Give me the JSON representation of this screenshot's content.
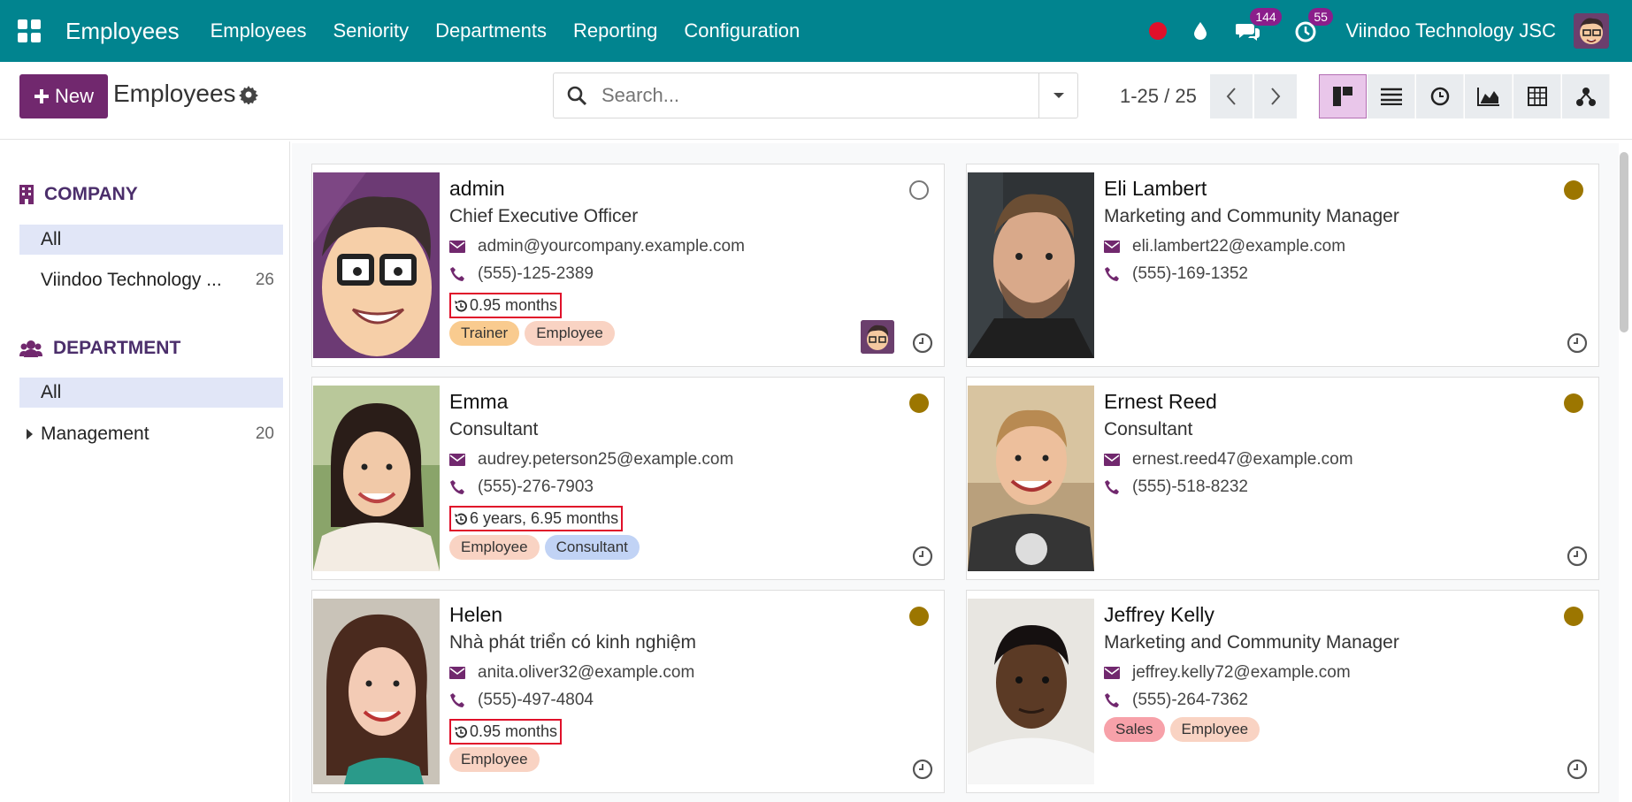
{
  "navbar": {
    "app_title": "Employees",
    "menu": [
      "Employees",
      "Seniority",
      "Departments",
      "Reporting",
      "Configuration"
    ],
    "messages_count": "144",
    "activities_count": "55",
    "company": "Viindoo Technology JSC",
    "accent": "#01848f"
  },
  "control": {
    "new_label": "New",
    "breadcrumb": "Employees",
    "search_placeholder": "Search...",
    "pager": "1-25 / 25",
    "views": [
      "kanban",
      "list",
      "activity",
      "graph",
      "pivot",
      "hierarchy"
    ]
  },
  "sidebar": {
    "company_header": "COMPANY",
    "company_items": [
      {
        "label": "All",
        "count": ""
      },
      {
        "label": "Viindoo Technology ...",
        "count": "26"
      }
    ],
    "department_header": "DEPARTMENT",
    "department_items": [
      {
        "label": "All",
        "count": ""
      },
      {
        "label": "Management",
        "count": "20"
      }
    ]
  },
  "employees": [
    {
      "name": "admin",
      "job": "Chief Executive Officer",
      "email": "admin@yourcompany.example.com",
      "phone": "(555)-125-2389",
      "seniority": "0.95 months",
      "tags": [
        "Trainer",
        "Employee"
      ],
      "status": "offline"
    },
    {
      "name": "Eli Lambert",
      "job": "Marketing and Community Manager",
      "email": "eli.lambert22@example.com",
      "phone": "(555)-169-1352",
      "seniority": "",
      "tags": [],
      "status": "away"
    },
    {
      "name": "Emma",
      "job": "Consultant",
      "email": "audrey.peterson25@example.com",
      "phone": "(555)-276-7903",
      "seniority": "6 years, 6.95 months",
      "tags": [
        "Employee",
        "Consultant"
      ],
      "status": "away"
    },
    {
      "name": "Ernest Reed",
      "job": "Consultant",
      "email": "ernest.reed47@example.com",
      "phone": "(555)-518-8232",
      "seniority": "",
      "tags": [],
      "status": "away"
    },
    {
      "name": "Helen",
      "job": "Nhà phát triển có kinh nghiệm",
      "email": "anita.oliver32@example.com",
      "phone": "(555)-497-4804",
      "seniority": "0.95 months",
      "tags": [
        "Employee"
      ],
      "status": "away"
    },
    {
      "name": "Jeffrey Kelly",
      "job": "Marketing and Community Manager",
      "email": "jeffrey.kelly72@example.com",
      "phone": "(555)-264-7362",
      "seniority": "",
      "tags": [
        "Sales",
        "Employee"
      ],
      "status": "away"
    }
  ],
  "tag_colors": {
    "Trainer": "#f9cb8f",
    "Employee": "#f9d3c3",
    "Consultant": "#c1d3f5",
    "Sales": "#f7a1a9"
  }
}
